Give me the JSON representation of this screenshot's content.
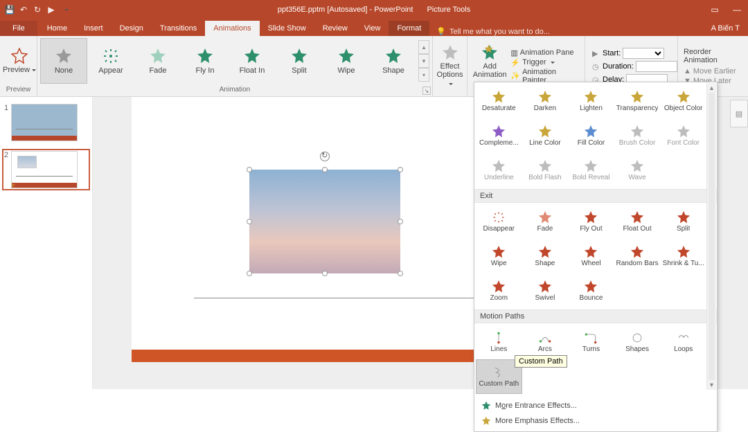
{
  "title": {
    "doc": "ppt356E.pptm [Autosaved] - PowerPoint",
    "contextual_tab_group": "Picture Tools"
  },
  "user": "A Biến T",
  "tabs": {
    "file": "File",
    "home": "Home",
    "insert": "Insert",
    "design": "Design",
    "transitions": "Transitions",
    "animations": "Animations",
    "slideshow": "Slide Show",
    "review": "Review",
    "view": "View",
    "format": "Format",
    "tellme": "Tell me what you want to do..."
  },
  "ribbon": {
    "preview": {
      "btn": "Preview",
      "group": "Preview"
    },
    "animation_group": "Animation",
    "gallery": {
      "none": "None",
      "appear": "Appear",
      "fade": "Fade",
      "flyin": "Fly In",
      "floatin": "Float In",
      "split": "Split",
      "wipe": "Wipe",
      "shape": "Shape"
    },
    "effect_options": "Effect\nOptions",
    "add_animation": "Add\nAnimation",
    "adv": {
      "pane": "Animation Pane",
      "trigger": "Trigger",
      "painter": "Animation Painter"
    },
    "timing": {
      "start": "Start:",
      "duration": "Duration:",
      "delay": "Delay:"
    },
    "reorder": {
      "title": "Reorder Animation",
      "earlier": "Move Earlier",
      "later": "Move Later"
    }
  },
  "thumbs": {
    "n1": "1",
    "n2": "2"
  },
  "dropdown": {
    "emphasis": {
      "desaturate": "Desaturate",
      "darken": "Darken",
      "lighten": "Lighten",
      "transparency": "Transparency",
      "objectcolor": "Object Color",
      "complementary": "Compleme...",
      "linecolor": "Line Color",
      "fillcolor": "Fill Color",
      "brushcolor": "Brush Color",
      "fontcolor": "Font Color",
      "underline": "Underline",
      "boldflash": "Bold Flash",
      "boldreveal": "Bold Reveal",
      "wave": "Wave"
    },
    "exit_hdr": "Exit",
    "exit": {
      "disappear": "Disappear",
      "fade": "Fade",
      "flyout": "Fly Out",
      "floatout": "Float Out",
      "split": "Split",
      "wipe": "Wipe",
      "shape": "Shape",
      "wheel": "Wheel",
      "randombars": "Random Bars",
      "shrinkturn": "Shrink & Tu...",
      "zoom": "Zoom",
      "swivel": "Swivel",
      "bounce": "Bounce"
    },
    "motion_hdr": "Motion Paths",
    "motion": {
      "lines": "Lines",
      "arcs": "Arcs",
      "turns": "Turns",
      "shapes": "Shapes",
      "loops": "Loops",
      "custompath": "Custom Path"
    },
    "footer": {
      "more_entrance_prefix": "M",
      "more_entrance_suffix": "ects...",
      "more_emphasis": "More Emphasis Effects..."
    },
    "tooltip": "Custom Path"
  },
  "colors": {
    "brand": "#b7472a",
    "entrance": "#2d8f6c",
    "emphasis": "#c9a63a",
    "exit": "#c0472b",
    "disabled": "#bdbdbd"
  }
}
